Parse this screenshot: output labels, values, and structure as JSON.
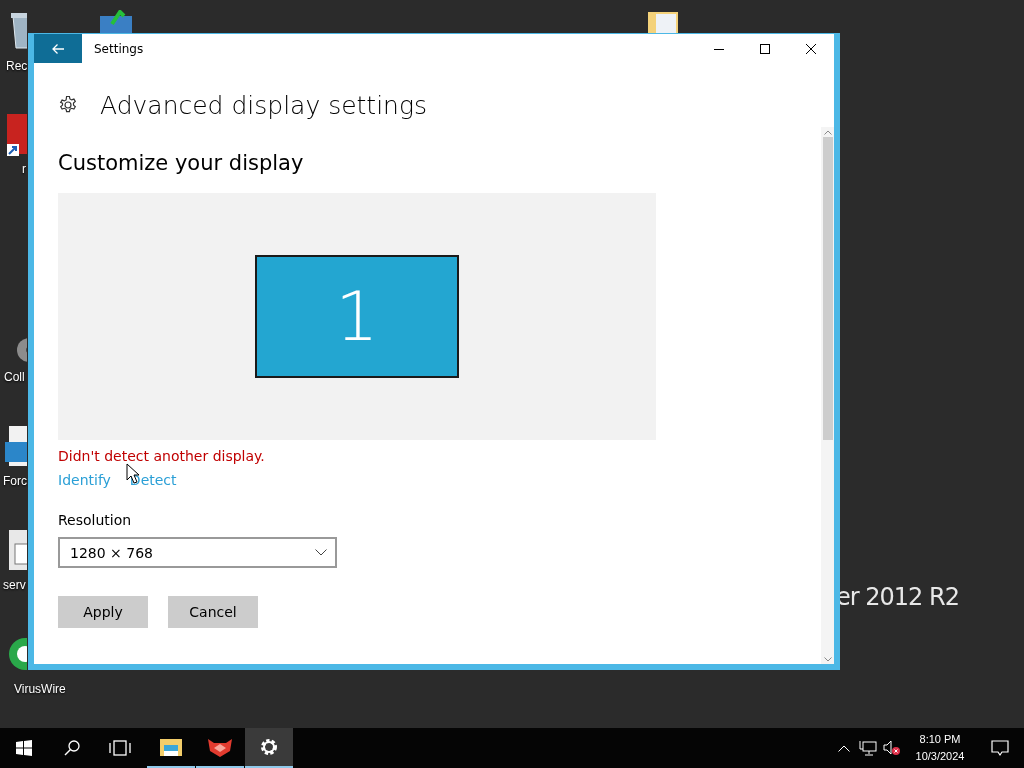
{
  "desktop": {
    "icons": [
      {
        "kind": "recycle-bin",
        "label": "Rec"
      },
      {
        "kind": "shortcut",
        "label": "r"
      },
      {
        "kind": "disc",
        "label": "Coll"
      },
      {
        "kind": "app",
        "label": "Forc"
      },
      {
        "kind": "document",
        "label": "serv"
      },
      {
        "kind": "round-app",
        "label": "VirusWire"
      }
    ],
    "branding": "er 2012 R2"
  },
  "window": {
    "title": "Settings",
    "page_title": "Advanced display settings",
    "section_title": "Customize your display",
    "display_number": "1",
    "detect_message": "Didn't detect another display.",
    "links": [
      "Identify",
      "Detect"
    ],
    "resolution": {
      "label": "Resolution",
      "value": "1280 × 768"
    },
    "buttons": [
      "Apply",
      "Cancel"
    ]
  },
  "taskbar": {
    "apps": [
      {
        "kind": "explorer",
        "running": true,
        "selected": false
      },
      {
        "kind": "mask-app",
        "running": true,
        "selected": false
      },
      {
        "kind": "settings",
        "running": true,
        "selected": true
      }
    ],
    "time": "8:10 PM",
    "date": "10/3/2024"
  }
}
